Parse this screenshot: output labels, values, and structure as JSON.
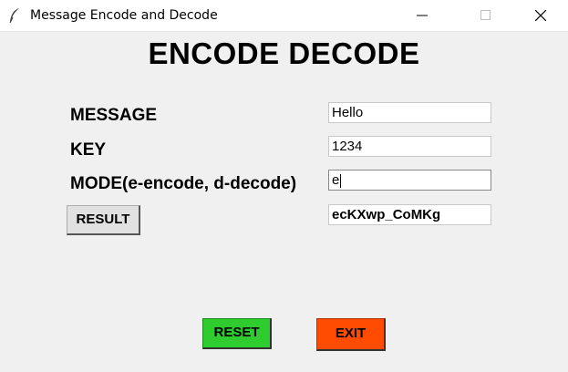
{
  "window": {
    "title": "Message Encode and Decode",
    "icon": "feather-icon"
  },
  "heading": "ENCODE DECODE",
  "form": {
    "message_label": "MESSAGE",
    "message_value": "Hello",
    "key_label": "KEY",
    "key_value": "1234",
    "mode_label": "MODE(e-encode, d-decode)",
    "mode_value": "e",
    "result_button": "RESULT",
    "result_value": "ecKXwp_CoMKg"
  },
  "buttons": {
    "reset": "RESET",
    "exit": "EXIT"
  },
  "colors": {
    "reset_bg": "#2ecc2e",
    "exit_bg": "#ff4c00"
  }
}
